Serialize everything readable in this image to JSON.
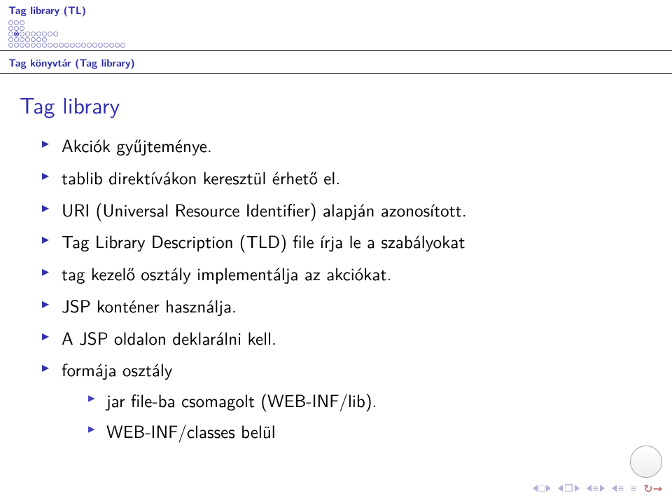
{
  "header": {
    "section": "Tag library (TL)",
    "subsection": "Tag könyvtár (Tag library)"
  },
  "frame_title": "Tag library",
  "items": [
    "Akciók gyűjteménye.",
    "tablib direktívákon keresztül érhető el.",
    "URI (Universal Resource Identifier) alapján azonosított.",
    "Tag Library Description (TLD) file írja le a szabályokat",
    "tag kezelő osztály implementálja az akciókat.",
    "JSP konténer használja.",
    "A JSP oldalon deklarálni kell.",
    "formája osztály"
  ],
  "sub_items": [
    "jar file-ba csomagolt (WEB-INF/lib).",
    "WEB-INF/classes belül"
  ],
  "progress_rows": [
    3,
    3,
    9,
    7,
    21
  ],
  "current_row": 2,
  "current_col": 1,
  "nav": {
    "frame_sym": "□",
    "sub_sym": "❐",
    "eq_sym": "≡",
    "loop_sym": "↻⇝"
  }
}
